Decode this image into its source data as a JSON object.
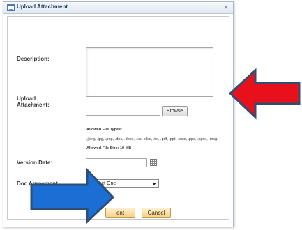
{
  "dialog": {
    "title": "Upload Attachment",
    "close_glyph": "x",
    "title_icon": "dialog-window-icon"
  },
  "form": {
    "description_label": "Description:",
    "description_value": "",
    "upload_label_line1": "Upload",
    "upload_label_line2": "Attachment:",
    "file_value": "",
    "browse_label": "Browse",
    "allowed_types_label": "Allowed File Types:",
    "allowed_types_list": ".jpeg, .jpg, .png, .doc, .docx, .xls, .xlsx, .txt, .pdf, .ppt, .pptx, .pps, .ppsx, .msg.",
    "allowed_size": "Allowed File Size: 10 MB",
    "version_date_label": "Version Date:",
    "version_date_value": "",
    "calendar_icon": "calendar-icon",
    "doc_agreement_label": "Doc Agreement",
    "doc_agreement_selected": "--Select One--"
  },
  "actions": {
    "submit_label_visible": "ent",
    "cancel_label": "Cancel"
  },
  "colors": {
    "red_arrow": "#e8101a",
    "blue_arrow": "#1b6fd4",
    "arrow_outline": "#2f4e74",
    "button_fill": "#f5cf86",
    "title_text": "#1f3b5a"
  }
}
